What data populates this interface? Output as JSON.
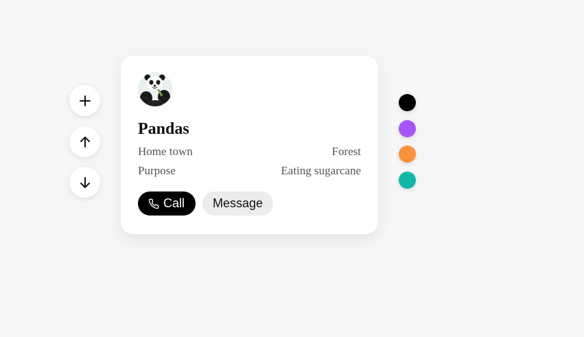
{
  "controls": {
    "add_icon": "plus-icon",
    "up_icon": "arrow-up-icon",
    "down_icon": "arrow-down-icon"
  },
  "card": {
    "avatar_icon": "panda-avatar",
    "name": "Pandas",
    "details": [
      {
        "label": "Home town",
        "value": "Forest"
      },
      {
        "label": "Purpose",
        "value": "Eating sugarcane"
      }
    ],
    "call_label": "Call",
    "call_icon": "phone-icon",
    "message_label": "Message"
  },
  "swatches": [
    {
      "name": "black",
      "color": "#000000"
    },
    {
      "name": "purple",
      "color": "#a855f7"
    },
    {
      "name": "orange",
      "color": "#fb923c"
    },
    {
      "name": "teal",
      "color": "#14b8a6"
    }
  ]
}
